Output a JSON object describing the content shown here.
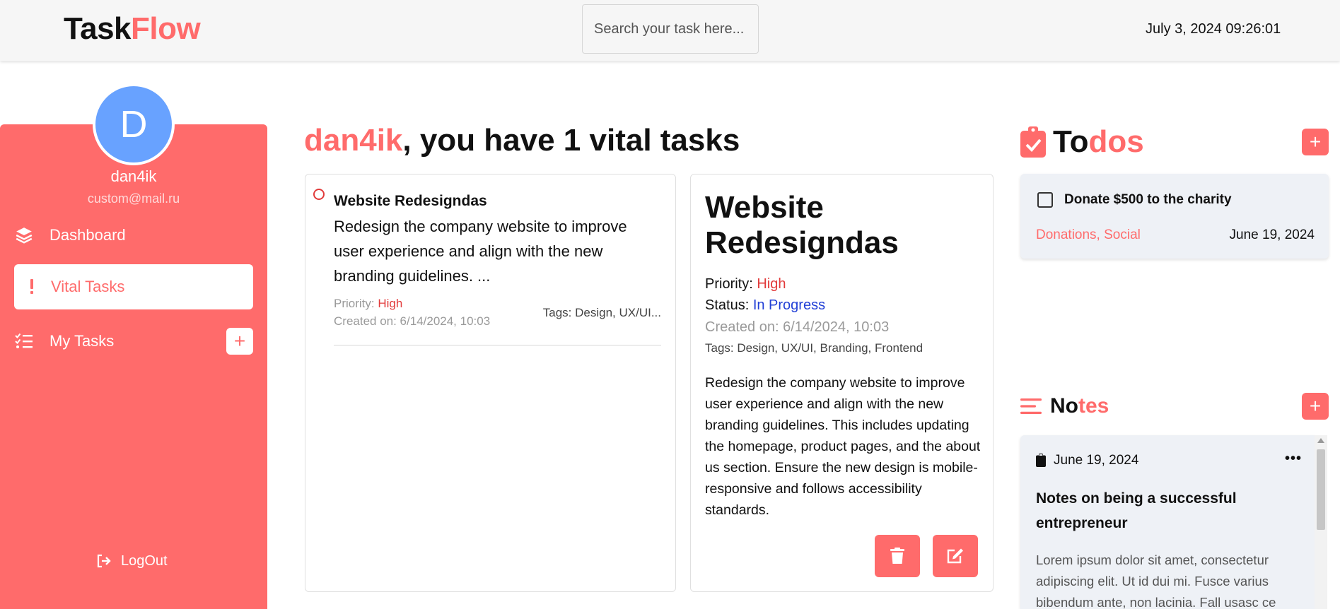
{
  "header": {
    "logo_part1": "Task",
    "logo_part2": "Flow",
    "search_placeholder": "Search your task here...",
    "datetime": "July 3, 2024 09:26:01"
  },
  "sidebar": {
    "avatar_letter": "D",
    "username": "dan4ik",
    "email": "custom@mail.ru",
    "items": [
      {
        "label": "Dashboard",
        "icon": "layers-icon"
      },
      {
        "label": "Vital Tasks",
        "icon": "exclamation-icon",
        "active": true
      },
      {
        "label": "My Tasks",
        "icon": "checklist-icon"
      }
    ],
    "add_task_label": "+",
    "logout_label": "LogOut"
  },
  "main": {
    "greeting_user": "dan4ik",
    "greeting_text": ", you have 1 vital tasks",
    "task": {
      "title": "Website Redesigndas",
      "description": "Redesign the company website to improve user experience and align with the new branding guidelines. ...",
      "priority_label": "Priority: ",
      "priority_value": "High",
      "created": "Created on: 6/14/2024, 10:03",
      "tags": "Tags: Design, UX/UI..."
    },
    "detail": {
      "title": "Website Redesigndas",
      "priority_label": "Priority: ",
      "priority_value": "High",
      "status_label": "Status: ",
      "status_value": "In Progress",
      "created": "Created on: 6/14/2024, 10:03",
      "tags": "Tags: Design, UX/UI, Branding, Frontend",
      "description": "Redesign the company website to improve user experience and align with the new branding guidelines. This includes updating the homepage, product pages, and the about us section. Ensure the new design is mobile-responsive and follows accessibility standards."
    }
  },
  "todos": {
    "title_part1": "To",
    "title_part2": "dos",
    "add_label": "+",
    "items": [
      {
        "title": "Donate $500 to the charity",
        "tags": "Donations, Social",
        "date": "June 19, 2024",
        "checked": false
      }
    ]
  },
  "notes": {
    "title_part1": "No",
    "title_part2": "tes",
    "add_label": "+",
    "items": [
      {
        "date": "June 19, 2024",
        "more": "•••",
        "title": "Notes on being a successful entrepreneur",
        "body": "Lorem ipsum dolor sit amet, consectetur adipiscing elit. Ut id dui mi. Fusce varius bibendum ante, non lacinia. Fall usasc ce"
      }
    ]
  },
  "colors": {
    "accent": "#ff6b6b",
    "avatar": "#68a2ff",
    "status_in_progress": "#2240d6",
    "priority_high": "#e23b3b"
  }
}
